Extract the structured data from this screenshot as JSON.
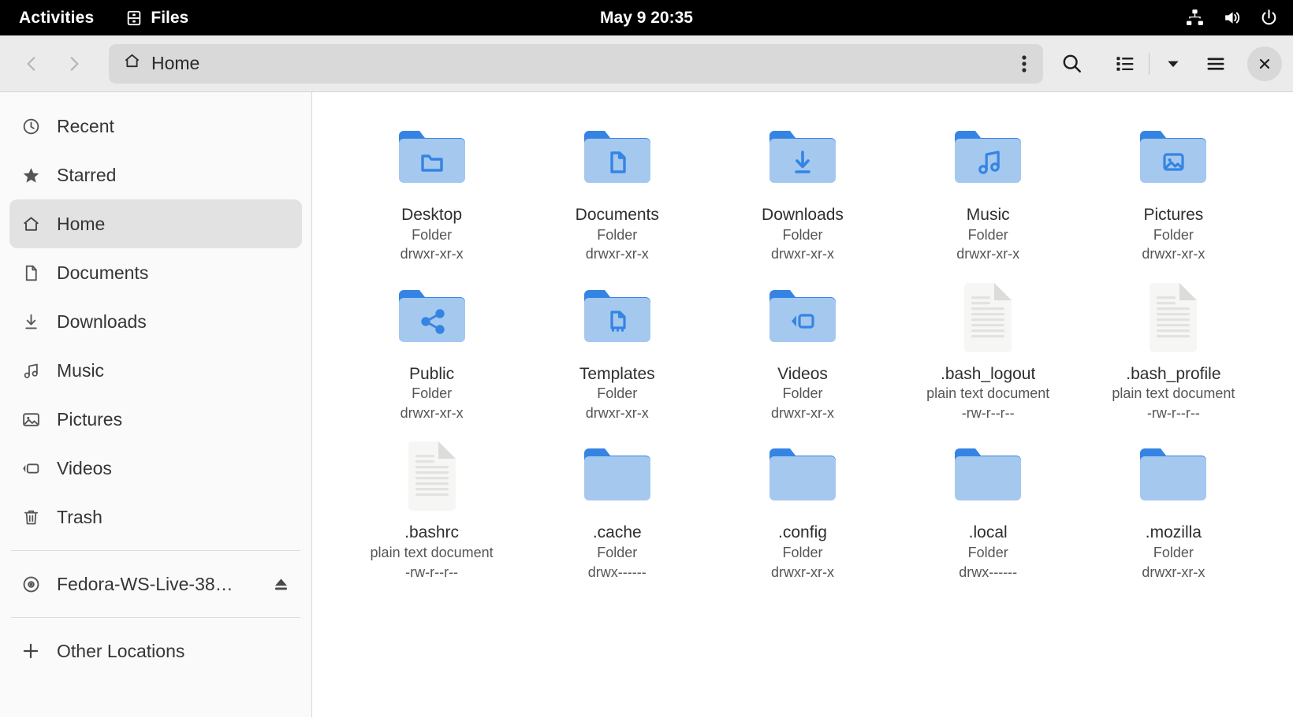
{
  "topbar": {
    "activities": "Activities",
    "app_name": "Files",
    "app_icon": "files-cabinet-icon",
    "clock": "May 9  20:35",
    "indicators": [
      "network-wired-icon",
      "volume-icon",
      "power-icon"
    ]
  },
  "headerbar": {
    "back_icon": "chevron-left-icon",
    "forward_icon": "chevron-right-icon",
    "path_label": "Home",
    "path_icon": "home-icon",
    "path_menu_icon": "vertical-dots-icon",
    "search_icon": "search-icon",
    "view_list_icon": "list-view-icon",
    "view_dropdown_icon": "chevron-down-icon",
    "menu_icon": "hamburger-menu-icon",
    "close_icon": "close-icon"
  },
  "sidebar": {
    "items": [
      {
        "label": "Recent",
        "icon": "clock-icon",
        "selected": false
      },
      {
        "label": "Starred",
        "icon": "star-icon",
        "selected": false
      },
      {
        "label": "Home",
        "icon": "home-icon",
        "selected": true
      },
      {
        "label": "Documents",
        "icon": "document-icon",
        "selected": false
      },
      {
        "label": "Downloads",
        "icon": "download-icon",
        "selected": false
      },
      {
        "label": "Music",
        "icon": "music-icon",
        "selected": false
      },
      {
        "label": "Pictures",
        "icon": "image-icon",
        "selected": false
      },
      {
        "label": "Videos",
        "icon": "video-icon",
        "selected": false
      },
      {
        "label": "Trash",
        "icon": "trash-icon",
        "selected": false
      }
    ],
    "devices": [
      {
        "label": "Fedora-WS-Live-38…",
        "icon": "disc-icon",
        "eject_icon": "eject-icon"
      }
    ],
    "other": {
      "label": "Other Locations",
      "icon": "plus-icon"
    }
  },
  "files": [
    {
      "name": "Desktop",
      "type": "Folder",
      "perm": "drwxr-xr-x",
      "icon": "folder-desktop-icon"
    },
    {
      "name": "Documents",
      "type": "Folder",
      "perm": "drwxr-xr-x",
      "icon": "folder-documents-icon"
    },
    {
      "name": "Downloads",
      "type": "Folder",
      "perm": "drwxr-xr-x",
      "icon": "folder-downloads-icon"
    },
    {
      "name": "Music",
      "type": "Folder",
      "perm": "drwxr-xr-x",
      "icon": "folder-music-icon"
    },
    {
      "name": "Pictures",
      "type": "Folder",
      "perm": "drwxr-xr-x",
      "icon": "folder-pictures-icon"
    },
    {
      "name": "Public",
      "type": "Folder",
      "perm": "drwxr-xr-x",
      "icon": "folder-public-icon"
    },
    {
      "name": "Templates",
      "type": "Folder",
      "perm": "drwxr-xr-x",
      "icon": "folder-templates-icon"
    },
    {
      "name": "Videos",
      "type": "Folder",
      "perm": "drwxr-xr-x",
      "icon": "folder-videos-icon"
    },
    {
      "name": ".bash_logout",
      "type": "plain text document",
      "perm": "-rw-r--r--",
      "icon": "text-file-icon"
    },
    {
      "name": ".bash_profile",
      "type": "plain text document",
      "perm": "-rw-r--r--",
      "icon": "text-file-icon"
    },
    {
      "name": ".bashrc",
      "type": "plain text document",
      "perm": "-rw-r--r--",
      "icon": "text-file-icon"
    },
    {
      "name": ".cache",
      "type": "Folder",
      "perm": "drwx------",
      "icon": "folder-icon"
    },
    {
      "name": ".config",
      "type": "Folder",
      "perm": "drwxr-xr-x",
      "icon": "folder-icon"
    },
    {
      "name": ".local",
      "type": "Folder",
      "perm": "drwx------",
      "icon": "folder-icon"
    },
    {
      "name": ".mozilla",
      "type": "Folder",
      "perm": "drwxr-xr-x",
      "icon": "folder-icon"
    }
  ],
  "colors": {
    "folder_tab": "#3584e4",
    "folder_body": "#a5c8ef",
    "folder_emblem": "#3584e4",
    "topbar_bg": "#000000",
    "headerbar_bg": "#ebebeb",
    "sidebar_bg": "#fafafa",
    "selection_bg": "#e2e2e2"
  }
}
